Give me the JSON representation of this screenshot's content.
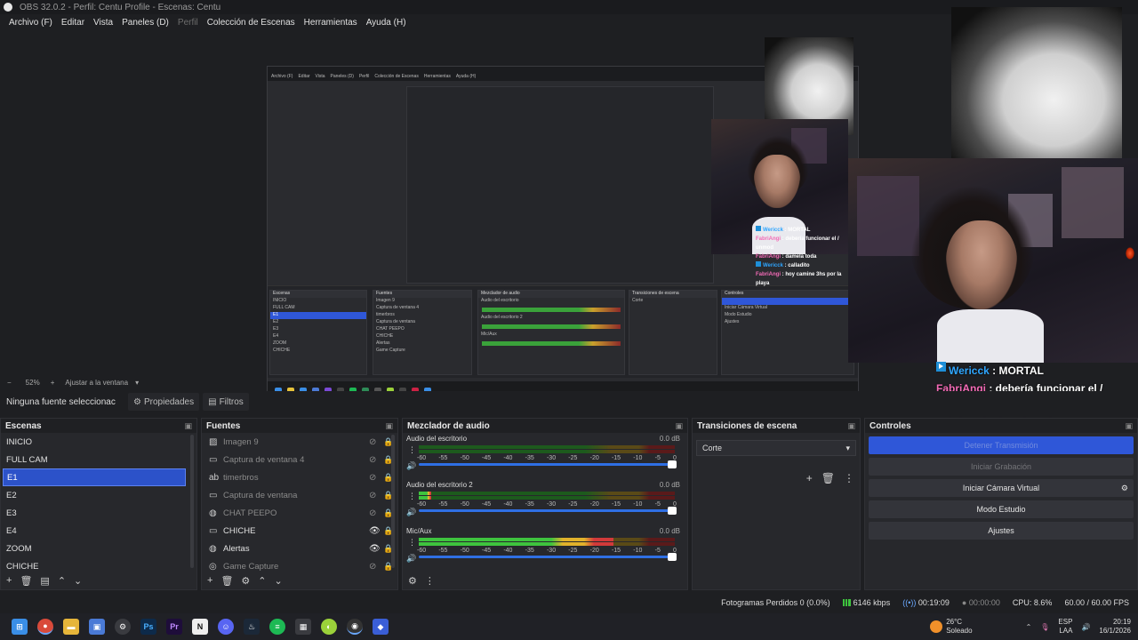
{
  "window": {
    "title": "OBS 32.0.2 - Perfil: Centu Profile - Escenas: Centu"
  },
  "menu": [
    {
      "label": "Archivo (F)",
      "dim": false
    },
    {
      "label": "Editar",
      "dim": false
    },
    {
      "label": "Vista",
      "dim": false
    },
    {
      "label": "Paneles (D)",
      "dim": false
    },
    {
      "label": "Perfil",
      "dim": true
    },
    {
      "label": "Colección de Escenas",
      "dim": false
    },
    {
      "label": "Herramientas",
      "dim": false
    },
    {
      "label": "Ayuda (H)",
      "dim": false
    }
  ],
  "zoom": {
    "minus": "−",
    "value": "52%",
    "plus": "+",
    "fit_label": "Ajustar a la ventana"
  },
  "properties_bar": {
    "no_source": "Ninguna fuente seleccionac",
    "properties_label": "Propiedades",
    "filters_label": "Filtros"
  },
  "chat_big": [
    {
      "user": "Wericck",
      "type": "w",
      "text": "MORTAL"
    },
    {
      "user": "FabriAngi",
      "type": "f",
      "text": "debería funcionar el / unmod"
    },
    {
      "user": "FabriAngi",
      "type": "f",
      "text": "damela toda"
    },
    {
      "user": "Wericck",
      "type": "w",
      "text": "calladito"
    },
    {
      "user": "FabriAngi",
      "type": "f",
      "text": "hoy camine 3hs por la playa"
    }
  ],
  "chat_big_overlap": {
    "stop_stream": "Detener Transmisión",
    "start_record": "Iniciar Grabación"
  },
  "scenes": {
    "title": "Escenas",
    "items": [
      "INICIO",
      "FULL CAM",
      "E1",
      "E2",
      "E3",
      "E4",
      "ZOOM",
      "CHICHE"
    ],
    "selected": 2
  },
  "sources": {
    "title": "Fuentes",
    "items": [
      {
        "label": "Imagen 9",
        "icon": "image-icon",
        "visible": false
      },
      {
        "label": "Captura de ventana 4",
        "icon": "window-icon",
        "visible": false
      },
      {
        "label": "timerbros",
        "icon": "text-icon",
        "visible": false
      },
      {
        "label": "Captura de ventana",
        "icon": "window-icon",
        "visible": false
      },
      {
        "label": "CHAT PEEPO",
        "icon": "globe-icon",
        "visible": false
      },
      {
        "label": "CHICHE",
        "icon": "window-icon",
        "visible": true
      },
      {
        "label": "Alertas",
        "icon": "globe-icon",
        "visible": true
      },
      {
        "label": "Game Capture",
        "icon": "gamepad-icon",
        "visible": false
      }
    ]
  },
  "mixer": {
    "title": "Mezclador de audio",
    "scale": [
      "-60",
      "-55",
      "-50",
      "-45",
      "-40",
      "-35",
      "-30",
      "-25",
      "-20",
      "-15",
      "-10",
      "-5",
      "0"
    ],
    "channels": [
      {
        "name": "Audio del escritorio",
        "db": "0.0 dB",
        "level": 0
      },
      {
        "name": "Audio del escritorio 2",
        "db": "0.0 dB",
        "level": 0.05
      },
      {
        "name": "Mic/Aux",
        "db": "0.0 dB",
        "level": 0.76
      }
    ]
  },
  "transitions": {
    "title": "Transiciones de escena",
    "selected": "Corte"
  },
  "controls": {
    "title": "Controles",
    "virtual_cam": "Iniciar Cámara Virtual",
    "studio_mode": "Modo Estudio",
    "settings": "Ajustes"
  },
  "status": {
    "dropped": "Fotogramas Perdidos 0 (0.0%)",
    "kbps": "6146 kbps",
    "stream_time": "00:19:09",
    "rec_time": "00:00:00",
    "cpu": "CPU: 8.6%",
    "fps": "60.00 / 60.00 FPS"
  },
  "tray": {
    "temp": "26°C",
    "weather": "Soleado",
    "lang": "ESP",
    "region": "LAA",
    "time": "20:19",
    "date": "16/1/2026"
  },
  "colors": {
    "accent": "#2f57d8",
    "wericck": "#2fa6ff",
    "fabriangi": "#f36bb6"
  }
}
